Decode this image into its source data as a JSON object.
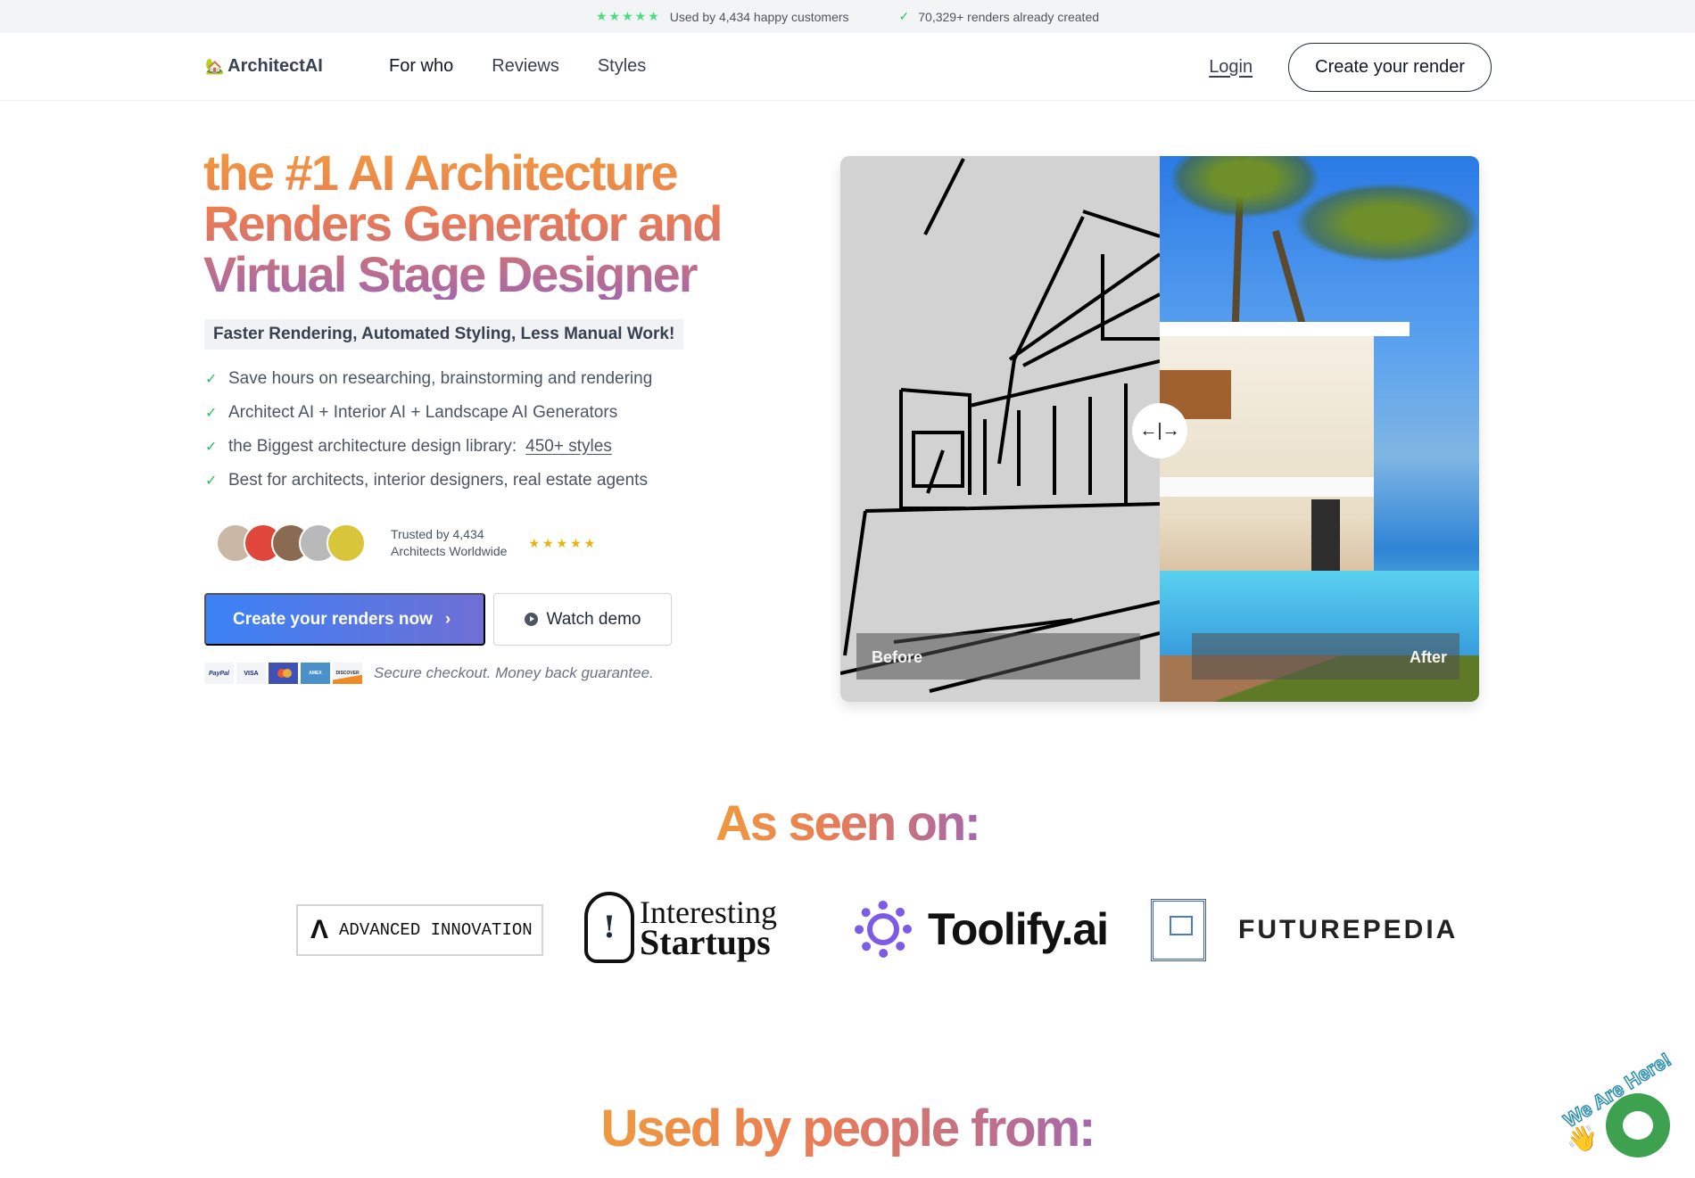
{
  "topbar": {
    "rating_stars": "★★★★★",
    "customers_text": "Used by 4,434 happy customers",
    "check": "✓",
    "renders_text": "70,329+ renders already created"
  },
  "nav": {
    "logo_icon": "🏡",
    "logo_text": "ArchitectAI",
    "links": [
      "For who",
      "Reviews",
      "Styles"
    ],
    "login": "Login",
    "cta": "Create your render"
  },
  "hero": {
    "headline": "the #1 AI Architecture Renders Generator and Virtual Stage Designer",
    "subhead": "Faster Rendering, Automated Styling, Less Manual Work!",
    "bullets": [
      {
        "text": "Save hours on researching, brainstorming and rendering"
      },
      {
        "text": "Architect AI + Interior AI + Landscape AI Generators"
      },
      {
        "text": "the Biggest architecture design library:",
        "link": "450+ styles"
      },
      {
        "text": "Best for architects, interior designers, real estate agents"
      }
    ],
    "check": "✓",
    "trust_line1": "Trusted by 4,434",
    "trust_line2": "Architects Worldwide",
    "trust_stars": "★★★★★",
    "avatar_colors": [
      "#c9b8a6",
      "#e0463a",
      "#8a6b52",
      "#b9b9b9",
      "#d9c53a"
    ],
    "primary_cta": "Create your renders now",
    "primary_cta_icon": "›",
    "secondary_cta": "Watch demo",
    "payment_cards": [
      "PayPal",
      "VISA",
      "Mastercard",
      "AMEX",
      "DISCOVER"
    ],
    "payment_text": "Secure checkout. Money back guarantee."
  },
  "compare": {
    "before_label": "Before",
    "after_label": "After",
    "handle_icon": "←|→",
    "slider_position_percent": 50
  },
  "as_seen_on": {
    "title": "As seen on:",
    "logos": {
      "advanced_innovation": "ADVANCED INNOVATION",
      "advanced_mark": "Λ",
      "interesting_1": "Interesting",
      "interesting_2": "Startups",
      "bulb_mark": "!",
      "toolify": "Toolify.ai",
      "futurepedia": "FUTUREPEDIA"
    }
  },
  "used_by": {
    "title": "Used by people from:"
  },
  "chat_widget": {
    "arc_text": "We Are Here!",
    "wave": "👋"
  },
  "colors": {
    "accent_orange": "#ef9a3d",
    "accent_purple": "#a468ac",
    "cta_blue": "#3b82f6",
    "check_green": "#22c55e",
    "star_gold": "#eab308",
    "chat_green": "#3ea14f"
  }
}
